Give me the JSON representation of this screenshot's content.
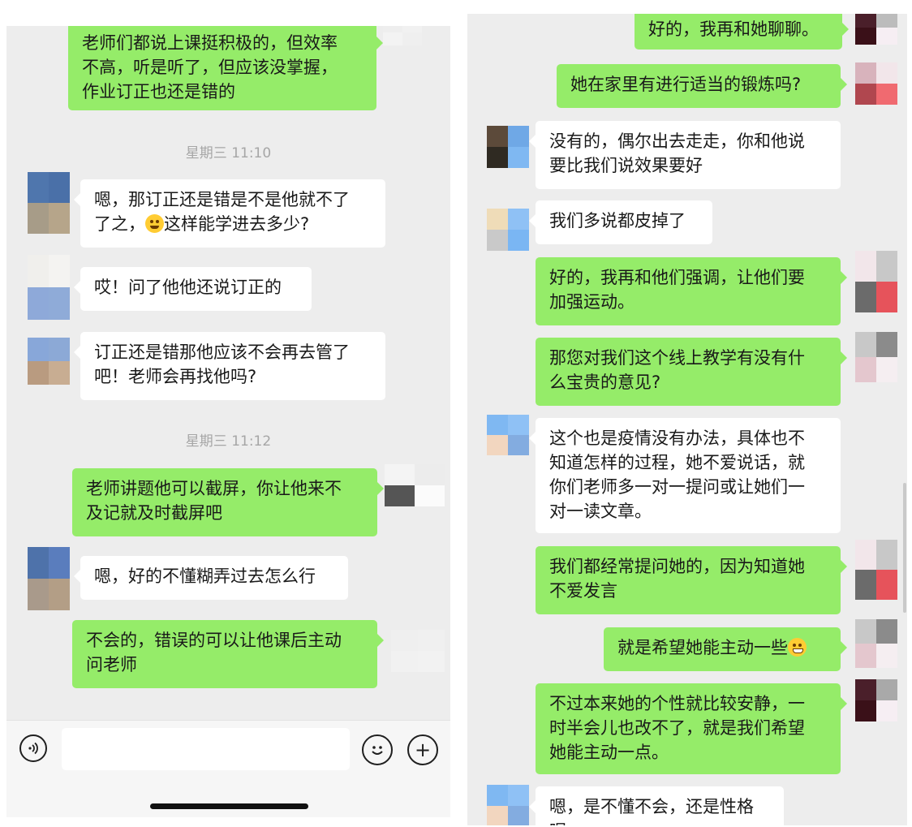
{
  "left_chat": {
    "messages": [
      {
        "direction": "out",
        "lines": [
          "老师们都说上课挺积极的，但效率",
          "不高，听是听了，但应该没掌握，",
          "作业订正也还是错的"
        ]
      },
      {
        "timestamp": "星期三 11:10"
      },
      {
        "direction": "in",
        "lines": [
          "嗯，那订正还是错是不是他就不了",
          "了之，",
          "这样能学进去多少?"
        ],
        "emoji": "dizzy-face"
      },
      {
        "direction": "in",
        "lines": [
          "哎！问了他他还说订正的"
        ]
      },
      {
        "direction": "in",
        "lines": [
          "订正还是错那他应该不会再去管了",
          "吧！老师会再找他吗?"
        ]
      },
      {
        "timestamp": "星期三 11:12"
      },
      {
        "direction": "out",
        "lines": [
          "老师讲题他可以截屏，你让他来不",
          "及记就及时截屏吧"
        ]
      },
      {
        "direction": "in",
        "lines": [
          "嗯，好的不懂糊弄过去怎么行"
        ]
      },
      {
        "direction": "out",
        "lines": [
          "不会的，错误的可以让他课后主动",
          "问老师"
        ]
      }
    ],
    "input_bar": {
      "voice_icon": "voice-icon",
      "emoji_icon": "emoji-icon",
      "plus_icon": "plus-icon",
      "plus_glyph": "+",
      "input_value": ""
    }
  },
  "right_chat": {
    "messages": [
      {
        "direction": "out",
        "lines": [
          "好的，我再和她聊聊。"
        ]
      },
      {
        "direction": "out",
        "lines": [
          "她在家里有进行适当的锻炼吗?"
        ]
      },
      {
        "direction": "in",
        "lines": [
          "没有的，偶尔出去走走，你和他说",
          "要比我们说效果要好"
        ]
      },
      {
        "direction": "in",
        "lines": [
          "我们多说都皮掉了"
        ]
      },
      {
        "direction": "out",
        "lines": [
          "好的，我再和他们强调，让他们要",
          "加强运动。"
        ]
      },
      {
        "direction": "out",
        "lines": [
          "那您对我们这个线上教学有没有什",
          "么宝贵的意见?"
        ]
      },
      {
        "direction": "in",
        "lines": [
          "这个也是疫情没有办法，具体也不",
          "知道怎样的过程，她不爱说话，就",
          "你们老师多一对一提问或让她们一",
          "对一读文章。"
        ]
      },
      {
        "direction": "out",
        "lines": [
          "我们都经常提问她的，因为知道她",
          "不爱发言"
        ]
      },
      {
        "direction": "out",
        "lines": [
          "就是希望她能主动一些"
        ],
        "emoji": "grinning-face"
      },
      {
        "direction": "out",
        "lines": [
          "不过本来她的个性就比较安静，一",
          "时半会儿也改不了，就是我们希望",
          "她能主动一点。"
        ]
      },
      {
        "direction": "in",
        "lines": [
          "嗯，是不懂不会，还是性格呢"
        ]
      }
    ]
  },
  "colors": {
    "chat_background": "#ededed",
    "incoming_bubble": "#ffffff",
    "outgoing_bubble": "#95ec69",
    "timestamp_text": "#a6a6a6",
    "message_text": "#191919"
  }
}
